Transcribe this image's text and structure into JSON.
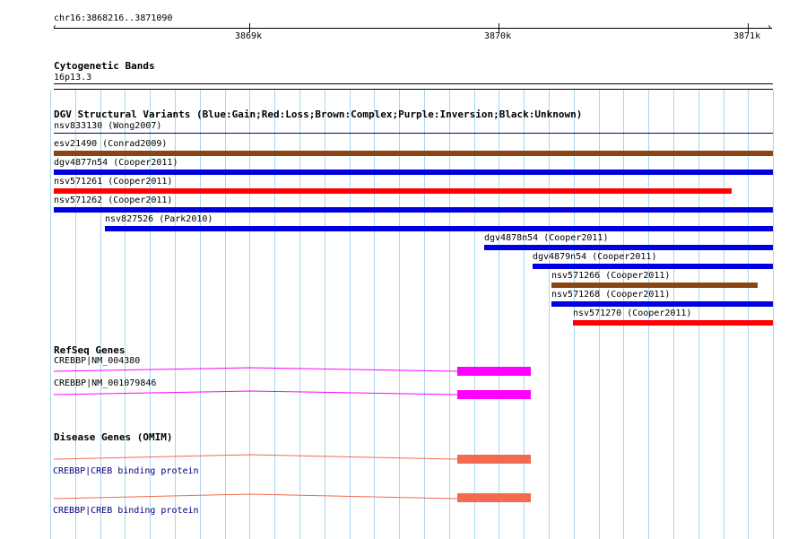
{
  "colors": {
    "gain": "#0000e0",
    "loss": "#ff0000",
    "complex": "#8b4513",
    "grid": "#a8d8ef",
    "refseq": "#ff00ff",
    "omim": "#f26a4f",
    "title_line": "#000080"
  },
  "ruler": {
    "locus": "chr16:3868216..3871090",
    "ticks": [
      "3869k",
      "3870k",
      "3871k"
    ]
  },
  "cytoband": {
    "title": "Cytogenetic Bands",
    "band": "16p13.3"
  },
  "dgv": {
    "title": "DGV Structural Variants (Blue:Gain;Red:Loss;Brown:Complex;Purple:Inversion;Black:Unknown)",
    "features": [
      {
        "label": "nsv833130 (Wong2007)",
        "type": "title_line"
      },
      {
        "label": "esv21490 (Conrad2009)",
        "type": "complex"
      },
      {
        "label": "dgv4877n54 (Cooper2011)",
        "type": "gain"
      },
      {
        "label": "nsv571261 (Cooper2011)",
        "type": "loss"
      },
      {
        "label": "nsv571262 (Cooper2011)",
        "type": "gain"
      },
      {
        "label": "nsv827526 (Park2010)",
        "type": "gain"
      },
      {
        "label": "dgv4878n54 (Cooper2011)",
        "type": "gain"
      },
      {
        "label": "dgv4879n54 (Cooper2011)",
        "type": "gain"
      },
      {
        "label": "nsv571266 (Cooper2011)",
        "type": "complex"
      },
      {
        "label": "nsv571268 (Cooper2011)",
        "type": "gain"
      },
      {
        "label": "nsv571270 (Cooper2011)",
        "type": "loss"
      }
    ]
  },
  "refseq": {
    "title": "RefSeq Genes",
    "transcripts": [
      "CREBBP|NM_004380",
      "CREBBP|NM_001079846"
    ]
  },
  "omim": {
    "title": "Disease Genes (OMIM)",
    "entries": [
      "CREBBP|CREB binding protein",
      "CREBBP|CREB binding protein"
    ]
  }
}
